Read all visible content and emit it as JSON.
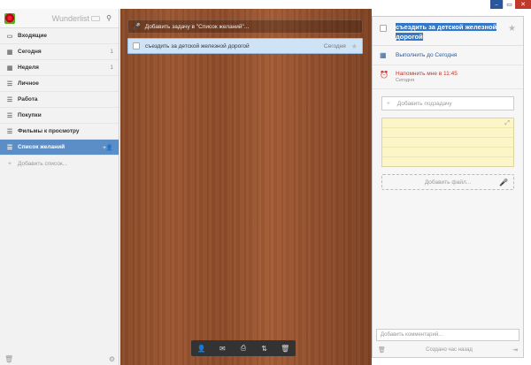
{
  "window": {
    "min_icon": "minimize-icon",
    "max_icon": "maximize-icon",
    "close_icon": "close-icon"
  },
  "sidebar": {
    "app_name": "Wunderlist",
    "items": [
      {
        "label": "Входящие",
        "icon": "inbox-icon",
        "count": ""
      },
      {
        "label": "Сегодня",
        "icon": "calendar-icon",
        "count": "1"
      },
      {
        "label": "Неделя",
        "icon": "calendar-week-icon",
        "count": "1"
      },
      {
        "label": "Личное",
        "icon": "list-icon",
        "count": ""
      },
      {
        "label": "Работа",
        "icon": "list-icon",
        "count": ""
      },
      {
        "label": "Покупки",
        "icon": "list-icon",
        "count": ""
      },
      {
        "label": "Фильмы к просмотру",
        "icon": "list-icon",
        "count": ""
      },
      {
        "label": "Список желаний",
        "icon": "list-icon",
        "count": ""
      }
    ],
    "add_list_label": "Добавить список...",
    "active_color": "#5b8ec7"
  },
  "main": {
    "add_task_placeholder": "Добавить задачу в \"Список желаний\"...",
    "task": {
      "title": "съездить за детской железной дорогой",
      "due": "Сегодня"
    },
    "toolbar": [
      "share-user-icon",
      "email-icon",
      "print-icon",
      "sort-icon",
      "trash-icon"
    ]
  },
  "detail": {
    "title": "съездить за детской железной дорогой",
    "due_label": "Выполнить до Сегодня",
    "reminder_label": "Напомнить мне в 11:45",
    "reminder_sub": "Сегодня",
    "subtask_placeholder": "Добавить подзадачу",
    "add_file_label": "Добавить файл...",
    "comment_placeholder": "Добавить комментарий...",
    "footer_text": "Создано час назад",
    "accent_blue": "#2b5b9a",
    "accent_red": "#c0392b"
  }
}
